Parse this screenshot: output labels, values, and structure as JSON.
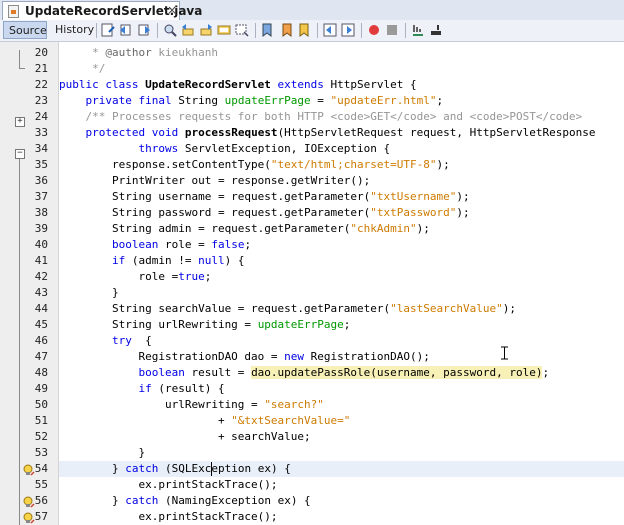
{
  "editor_tab": {
    "filename": "UpdateRecordServlet.java",
    "close_glyph": "×"
  },
  "toolbar": {
    "source_label": "Source",
    "history_label": "History"
  },
  "colors": {
    "keyword": "#0000e6",
    "string": "#ce7b00",
    "field": "#009900",
    "comment": "#969696",
    "highlight": "#f7f1b7"
  },
  "lines": [
    {
      "num": "20",
      "tokens": [
        {
          "c": "cm",
          "t": "     * "
        },
        {
          "c": "cmk",
          "t": "@author"
        },
        {
          "c": "cm",
          "t": " kieukhanh"
        }
      ]
    },
    {
      "num": "21",
      "tokens": [
        {
          "c": "cm",
          "t": "     */"
        }
      ]
    },
    {
      "num": "22",
      "tokens": [
        {
          "c": "kw",
          "t": "public class "
        },
        {
          "c": "b",
          "t": "UpdateRecordServlet "
        },
        {
          "c": "kw",
          "t": "extends "
        },
        {
          "c": "",
          "t": "HttpServlet {"
        }
      ]
    },
    {
      "num": "23",
      "tokens": [
        {
          "c": "kw",
          "t": "    private final "
        },
        {
          "c": "",
          "t": "String "
        },
        {
          "c": "fld",
          "t": "updateErrPage"
        },
        {
          "c": "",
          "t": " = "
        },
        {
          "c": "st",
          "t": "\"updateErr.html\""
        },
        {
          "c": "",
          "t": ";"
        }
      ]
    },
    {
      "num": "24",
      "tokens": [
        {
          "c": "cm",
          "t": "    /** Processes requests for both HTTP <code>GET</code> and <code>POST</code>"
        }
      ]
    },
    {
      "num": "33",
      "tokens": [
        {
          "c": "kw",
          "t": "    protected void "
        },
        {
          "c": "b",
          "t": "processRequest"
        },
        {
          "c": "",
          "t": "(HttpServletRequest request, HttpServletResponse"
        }
      ]
    },
    {
      "num": "34",
      "tokens": [
        {
          "c": "kw",
          "t": "            throws "
        },
        {
          "c": "",
          "t": "ServletException, IOException {"
        }
      ]
    },
    {
      "num": "35",
      "tokens": [
        {
          "c": "",
          "t": "        response.setContentType("
        },
        {
          "c": "st",
          "t": "\"text/html;charset=UTF-8\""
        },
        {
          "c": "",
          "t": ");"
        }
      ]
    },
    {
      "num": "36",
      "tokens": [
        {
          "c": "",
          "t": "        PrintWriter out = response.getWriter();"
        }
      ]
    },
    {
      "num": "37",
      "tokens": [
        {
          "c": "",
          "t": "        String username = request.getParameter("
        },
        {
          "c": "st",
          "t": "\"txtUsername\""
        },
        {
          "c": "",
          "t": ");"
        }
      ]
    },
    {
      "num": "38",
      "tokens": [
        {
          "c": "",
          "t": "        String password = request.getParameter("
        },
        {
          "c": "st",
          "t": "\"txtPassword\""
        },
        {
          "c": "",
          "t": ");"
        }
      ]
    },
    {
      "num": "39",
      "tokens": [
        {
          "c": "",
          "t": "        String admin = request.getParameter("
        },
        {
          "c": "st",
          "t": "\"chkAdmin\""
        },
        {
          "c": "",
          "t": ");"
        }
      ]
    },
    {
      "num": "40",
      "tokens": [
        {
          "c": "kw",
          "t": "        boolean "
        },
        {
          "c": "",
          "t": "role = "
        },
        {
          "c": "kw",
          "t": "false"
        },
        {
          "c": "",
          "t": ";"
        }
      ]
    },
    {
      "num": "41",
      "tokens": [
        {
          "c": "kw",
          "t": "        if "
        },
        {
          "c": "",
          "t": "(admin != "
        },
        {
          "c": "kw",
          "t": "null"
        },
        {
          "c": "",
          "t": ") {"
        }
      ]
    },
    {
      "num": "42",
      "tokens": [
        {
          "c": "",
          "t": "            role ="
        },
        {
          "c": "kw",
          "t": "true"
        },
        {
          "c": "",
          "t": ";"
        }
      ]
    },
    {
      "num": "43",
      "tokens": [
        {
          "c": "",
          "t": "        }"
        }
      ]
    },
    {
      "num": "44",
      "tokens": [
        {
          "c": "",
          "t": "        String searchValue = request.getParameter("
        },
        {
          "c": "st",
          "t": "\"lastSearchValue\""
        },
        {
          "c": "",
          "t": ");"
        }
      ]
    },
    {
      "num": "45",
      "tokens": [
        {
          "c": "",
          "t": "        String urlRewriting = "
        },
        {
          "c": "fld",
          "t": "updateErrPage"
        },
        {
          "c": "",
          "t": ";"
        }
      ]
    },
    {
      "num": "46",
      "tokens": [
        {
          "c": "kw",
          "t": "        try "
        },
        {
          "c": "",
          "t": " {"
        }
      ]
    },
    {
      "num": "47",
      "tokens": [
        {
          "c": "",
          "t": "            RegistrationDAO dao = "
        },
        {
          "c": "kw",
          "t": "new "
        },
        {
          "c": "",
          "t": "RegistrationDAO();"
        }
      ]
    },
    {
      "num": "48",
      "tokens": [
        {
          "c": "kw",
          "t": "            boolean "
        },
        {
          "c": "",
          "t": "result = "
        },
        {
          "c": "hl",
          "t": "dao.updatePassRole(username, password, role)"
        },
        {
          "c": "",
          "t": ";"
        }
      ]
    },
    {
      "num": "49",
      "tokens": [
        {
          "c": "kw",
          "t": "            if "
        },
        {
          "c": "",
          "t": "(result) {"
        }
      ]
    },
    {
      "num": "50",
      "tokens": [
        {
          "c": "",
          "t": "                urlRewriting = "
        },
        {
          "c": "st",
          "t": "\"search?\""
        }
      ]
    },
    {
      "num": "51",
      "tokens": [
        {
          "c": "",
          "t": "                        + "
        },
        {
          "c": "st",
          "t": "\"&txtSearchValue=\""
        }
      ]
    },
    {
      "num": "52",
      "tokens": [
        {
          "c": "",
          "t": "                        + searchValue;"
        }
      ]
    },
    {
      "num": "53",
      "tokens": [
        {
          "c": "",
          "t": "            }"
        }
      ]
    },
    {
      "num": "54",
      "tokens": [
        {
          "c": "",
          "t": "        } "
        },
        {
          "c": "kw",
          "t": "catch "
        },
        {
          "c": "",
          "t": "(SQLException ex) {"
        }
      ]
    },
    {
      "num": "55",
      "tokens": [
        {
          "c": "",
          "t": "            ex.printStackTrace();"
        }
      ]
    },
    {
      "num": "56",
      "tokens": [
        {
          "c": "",
          "t": "        } "
        },
        {
          "c": "kw",
          "t": "catch "
        },
        {
          "c": "",
          "t": "(NamingException ex) {"
        }
      ]
    },
    {
      "num": "57",
      "tokens": [
        {
          "c": "",
          "t": "            ex.printStackTrace();"
        }
      ]
    }
  ]
}
